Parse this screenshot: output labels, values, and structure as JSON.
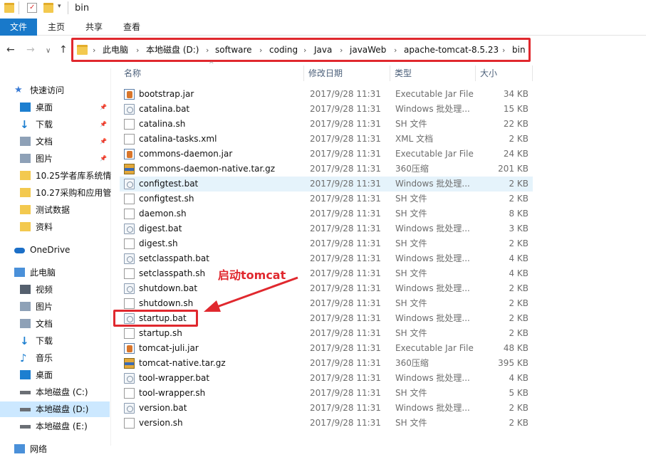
{
  "window": {
    "title": "bin"
  },
  "ribbon": {
    "tabs": [
      "文件",
      "主页",
      "共享",
      "查看"
    ]
  },
  "nav": {
    "back": "←",
    "forward": "→",
    "recent": "∨",
    "up": "↑",
    "breadcrumb": [
      "此电脑",
      "本地磁盘 (D:)",
      "software",
      "coding",
      "Java",
      "javaWeb",
      "apache-tomcat-8.5.23",
      "bin"
    ]
  },
  "sidebar": {
    "items": [
      {
        "label": "快速访问",
        "icon": "star-icon",
        "pinned": false
      },
      {
        "label": "桌面",
        "icon": "desktop-icon",
        "pinned": true
      },
      {
        "label": "下载",
        "icon": "download-icon",
        "pinned": true
      },
      {
        "label": "文档",
        "icon": "document-icon",
        "pinned": true
      },
      {
        "label": "图片",
        "icon": "picture-icon",
        "pinned": true
      },
      {
        "label": "10.25学者库系统情",
        "icon": "folder-icon",
        "pinned": false
      },
      {
        "label": "10.27采购和应用管",
        "icon": "folder-icon",
        "pinned": false
      },
      {
        "label": "测试数据",
        "icon": "folder-icon",
        "pinned": false
      },
      {
        "label": "资料",
        "icon": "folder-icon",
        "pinned": false
      },
      {
        "label": "OneDrive",
        "icon": "cloud-icon",
        "pinned": false
      },
      {
        "label": "此电脑",
        "icon": "computer-icon",
        "pinned": false
      },
      {
        "label": "视频",
        "icon": "video-icon",
        "pinned": false
      },
      {
        "label": "图片",
        "icon": "picture-icon",
        "pinned": false
      },
      {
        "label": "文档",
        "icon": "document-icon",
        "pinned": false
      },
      {
        "label": "下载",
        "icon": "download-icon",
        "pinned": false
      },
      {
        "label": "音乐",
        "icon": "music-icon",
        "pinned": false
      },
      {
        "label": "桌面",
        "icon": "desktop-icon",
        "pinned": false
      },
      {
        "label": "本地磁盘 (C:)",
        "icon": "drive-icon",
        "pinned": false
      },
      {
        "label": "本地磁盘 (D:)",
        "icon": "drive-icon",
        "pinned": false,
        "selected": true
      },
      {
        "label": "本地磁盘 (E:)",
        "icon": "drive-icon",
        "pinned": false
      },
      {
        "label": "网络",
        "icon": "network-icon",
        "pinned": false
      }
    ]
  },
  "columns": {
    "name": "名称",
    "date": "修改日期",
    "type": "类型",
    "size": "大小"
  },
  "files": [
    {
      "name": "bootstrap.jar",
      "date": "2017/9/28 11:31",
      "type": "Executable Jar File",
      "size": "34 KB",
      "icon": "jar"
    },
    {
      "name": "catalina.bat",
      "date": "2017/9/28 11:31",
      "type": "Windows 批处理...",
      "size": "15 KB",
      "icon": "bat"
    },
    {
      "name": "catalina.sh",
      "date": "2017/9/28 11:31",
      "type": "SH 文件",
      "size": "22 KB",
      "icon": "sh"
    },
    {
      "name": "catalina-tasks.xml",
      "date": "2017/9/28 11:31",
      "type": "XML 文档",
      "size": "2 KB",
      "icon": "xml"
    },
    {
      "name": "commons-daemon.jar",
      "date": "2017/9/28 11:31",
      "type": "Executable Jar File",
      "size": "24 KB",
      "icon": "jar"
    },
    {
      "name": "commons-daemon-native.tar.gz",
      "date": "2017/9/28 11:31",
      "type": "360压缩",
      "size": "201 KB",
      "icon": "tgz"
    },
    {
      "name": "configtest.bat",
      "date": "2017/9/28 11:31",
      "type": "Windows 批处理...",
      "size": "2 KB",
      "icon": "bat",
      "hover": true
    },
    {
      "name": "configtest.sh",
      "date": "2017/9/28 11:31",
      "type": "SH 文件",
      "size": "2 KB",
      "icon": "sh"
    },
    {
      "name": "daemon.sh",
      "date": "2017/9/28 11:31",
      "type": "SH 文件",
      "size": "8 KB",
      "icon": "sh"
    },
    {
      "name": "digest.bat",
      "date": "2017/9/28 11:31",
      "type": "Windows 批处理...",
      "size": "3 KB",
      "icon": "bat"
    },
    {
      "name": "digest.sh",
      "date": "2017/9/28 11:31",
      "type": "SH 文件",
      "size": "2 KB",
      "icon": "sh"
    },
    {
      "name": "setclasspath.bat",
      "date": "2017/9/28 11:31",
      "type": "Windows 批处理...",
      "size": "4 KB",
      "icon": "bat"
    },
    {
      "name": "setclasspath.sh",
      "date": "2017/9/28 11:31",
      "type": "SH 文件",
      "size": "4 KB",
      "icon": "sh"
    },
    {
      "name": "shutdown.bat",
      "date": "2017/9/28 11:31",
      "type": "Windows 批处理...",
      "size": "2 KB",
      "icon": "bat"
    },
    {
      "name": "shutdown.sh",
      "date": "2017/9/28 11:31",
      "type": "SH 文件",
      "size": "2 KB",
      "icon": "sh"
    },
    {
      "name": "startup.bat",
      "date": "2017/9/28 11:31",
      "type": "Windows 批处理...",
      "size": "2 KB",
      "icon": "bat",
      "annotated": true
    },
    {
      "name": "startup.sh",
      "date": "2017/9/28 11:31",
      "type": "SH 文件",
      "size": "2 KB",
      "icon": "sh"
    },
    {
      "name": "tomcat-juli.jar",
      "date": "2017/9/28 11:31",
      "type": "Executable Jar File",
      "size": "48 KB",
      "icon": "jar"
    },
    {
      "name": "tomcat-native.tar.gz",
      "date": "2017/9/28 11:31",
      "type": "360压缩",
      "size": "395 KB",
      "icon": "tgz"
    },
    {
      "name": "tool-wrapper.bat",
      "date": "2017/9/28 11:31",
      "type": "Windows 批处理...",
      "size": "4 KB",
      "icon": "bat"
    },
    {
      "name": "tool-wrapper.sh",
      "date": "2017/9/28 11:31",
      "type": "SH 文件",
      "size": "5 KB",
      "icon": "sh"
    },
    {
      "name": "version.bat",
      "date": "2017/9/28 11:31",
      "type": "Windows 批处理...",
      "size": "2 KB",
      "icon": "bat"
    },
    {
      "name": "version.sh",
      "date": "2017/9/28 11:31",
      "type": "SH 文件",
      "size": "2 KB",
      "icon": "sh"
    }
  ],
  "annotation": {
    "text": "启动tomcat",
    "color": "#e0282e"
  },
  "colors": {
    "accent": "#1979ca",
    "annotation_red": "#e0282e",
    "hover_row": "#e5f3fb",
    "selected_sidebar": "#cce8ff"
  }
}
